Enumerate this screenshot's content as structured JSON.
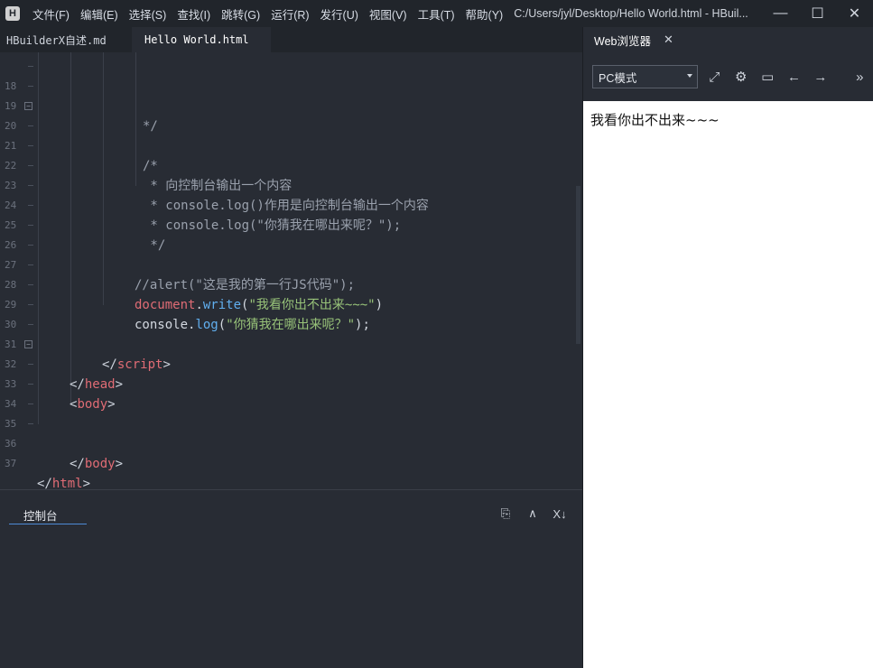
{
  "app": {
    "logo": "H",
    "window_title": "C:/Users/jyl/Desktop/Hello World.html - HBuil..."
  },
  "menu": [
    {
      "label": "文件(F)"
    },
    {
      "label": "编辑(E)"
    },
    {
      "label": "选择(S)"
    },
    {
      "label": "查找(I)"
    },
    {
      "label": "跳转(G)"
    },
    {
      "label": "运行(R)"
    },
    {
      "label": "发行(U)"
    },
    {
      "label": "视图(V)"
    },
    {
      "label": "工具(T)"
    },
    {
      "label": "帮助(Y)"
    }
  ],
  "window_controls": {
    "minimize": "—",
    "maximize": "☐",
    "close": "✕"
  },
  "editor_tabs": [
    {
      "label": "HBuilderX自述.md",
      "active": false
    },
    {
      "label": "Hello World.html",
      "active": true
    }
  ],
  "editor": {
    "lines": [
      {
        "num": "18",
        "fold": false
      },
      {
        "num": "19",
        "fold": false
      },
      {
        "num": "20",
        "fold": true
      },
      {
        "num": "21",
        "fold": false
      },
      {
        "num": "22",
        "fold": false
      },
      {
        "num": "23",
        "fold": false
      },
      {
        "num": "24",
        "fold": false
      },
      {
        "num": "25",
        "fold": false
      },
      {
        "num": "26",
        "fold": false
      },
      {
        "num": "27",
        "fold": false
      },
      {
        "num": "28",
        "fold": false
      },
      {
        "num": "29",
        "fold": false
      },
      {
        "num": "30",
        "fold": false
      },
      {
        "num": "31",
        "fold": false
      },
      {
        "num": "32",
        "fold": true
      },
      {
        "num": "33",
        "fold": false
      },
      {
        "num": "34",
        "fold": false
      },
      {
        "num": "35",
        "fold": false
      },
      {
        "num": "36",
        "fold": false
      },
      {
        "num": "37",
        "fold": false
      }
    ],
    "code": {
      "l18": "*/",
      "l20": "/*",
      "l21": " * 向控制台输出一个内容",
      "l22": " * console.log()作用是向控制台输出一个内容",
      "l23": " * console.log(\"你猜我在哪出来呢？\");",
      "l24": " */",
      "l26": "//alert(\"这是我的第一行JS代码\");",
      "l27_obj": "document",
      "l27_dot": ".",
      "l27_method": "write",
      "l27_open": "(",
      "l27_str": "\"我看你出不出来~~~\"",
      "l27_close": ")",
      "l28_obj": "console",
      "l28_dot": ".",
      "l28_method": "log",
      "l28_open": "(",
      "l28_str": "\"你猜我在哪出来呢？\"",
      "l28_close": ");",
      "l30_open": "</",
      "l30_tag": "script",
      "l30_close": ">",
      "l31_open": "</",
      "l31_tag": "head",
      "l31_close": ">",
      "l32_open": "<",
      "l32_tag": "body",
      "l32_close": ">",
      "l35_open": "</",
      "l35_tag": "body",
      "l35_close": ">",
      "l36_open": "</",
      "l36_tag": "html",
      "l36_close": ">"
    }
  },
  "console": {
    "tab_label": "控制台",
    "tools": {
      "new": "⎘",
      "collapse": "∧",
      "clear": "X↓"
    }
  },
  "browser": {
    "tab_label": "Web浏览器",
    "tab_close": "✕",
    "mode": "PC模式",
    "tools": {
      "expand": "⤢",
      "settings": "⚙",
      "terminal": "▭",
      "back": "←",
      "forward": "→",
      "more": "»"
    },
    "output_text": "我看你出不出来~~~"
  },
  "colors": {
    "editor_bg": "#282c34",
    "chrome_bg": "#21252b",
    "tag": "#e06c75",
    "string": "#98c379",
    "method": "#61afef",
    "comment": "#9aa1ad"
  }
}
